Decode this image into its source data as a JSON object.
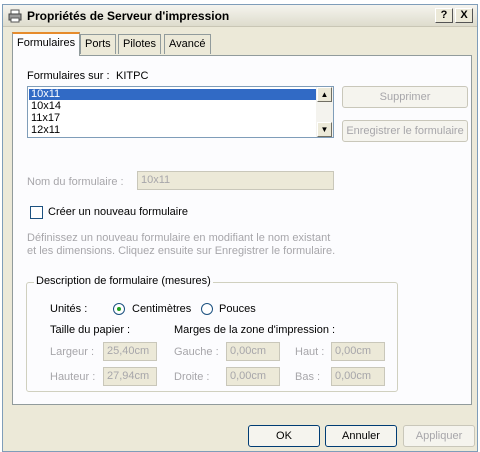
{
  "window": {
    "title": "Propriétés de Serveur d'impression",
    "help_btn": "?",
    "close_btn": "X"
  },
  "tabs": [
    "Formulaires",
    "Ports",
    "Pilotes",
    "Avancé"
  ],
  "forms_on": {
    "label": "Formulaires sur :",
    "server": "KITPC"
  },
  "form_list": {
    "items": [
      "10x11",
      "10x14",
      "11x17",
      "12x11"
    ],
    "selected": "10x11"
  },
  "buttons": {
    "delete": "Supprimer",
    "save_form": "Enregistrer le formulaire",
    "ok": "OK",
    "cancel": "Annuler",
    "apply": "Appliquer"
  },
  "form_name": {
    "label": "Nom du formulaire :",
    "value": "10x11"
  },
  "create_new": {
    "label": "Créer un nouveau formulaire",
    "checked": false
  },
  "hint": {
    "line1": "Définissez un nouveau formulaire en modifiant le nom existant",
    "line2": "et les dimensions. Cliquez ensuite sur Enregistrer le formulaire."
  },
  "description": {
    "title": "Description de formulaire (mesures)",
    "units_label": "Unités :",
    "unit_cm": "Centimètres",
    "unit_in": "Pouces",
    "unit_selected": "Centimètres",
    "paper_size_label": "Taille du papier :",
    "margins_label": "Marges de la zone d'impression :",
    "width_label": "Largeur :",
    "width_value": "25,40cm",
    "height_label": "Hauteur :",
    "height_value": "27,94cm",
    "left_label": "Gauche :",
    "left_value": "0,00cm",
    "right_label": "Droite :",
    "right_value": "0,00cm",
    "top_label": "Haut :",
    "top_value": "0,00cm",
    "bottom_label": "Bas :",
    "bottom_value": "0,00cm"
  }
}
